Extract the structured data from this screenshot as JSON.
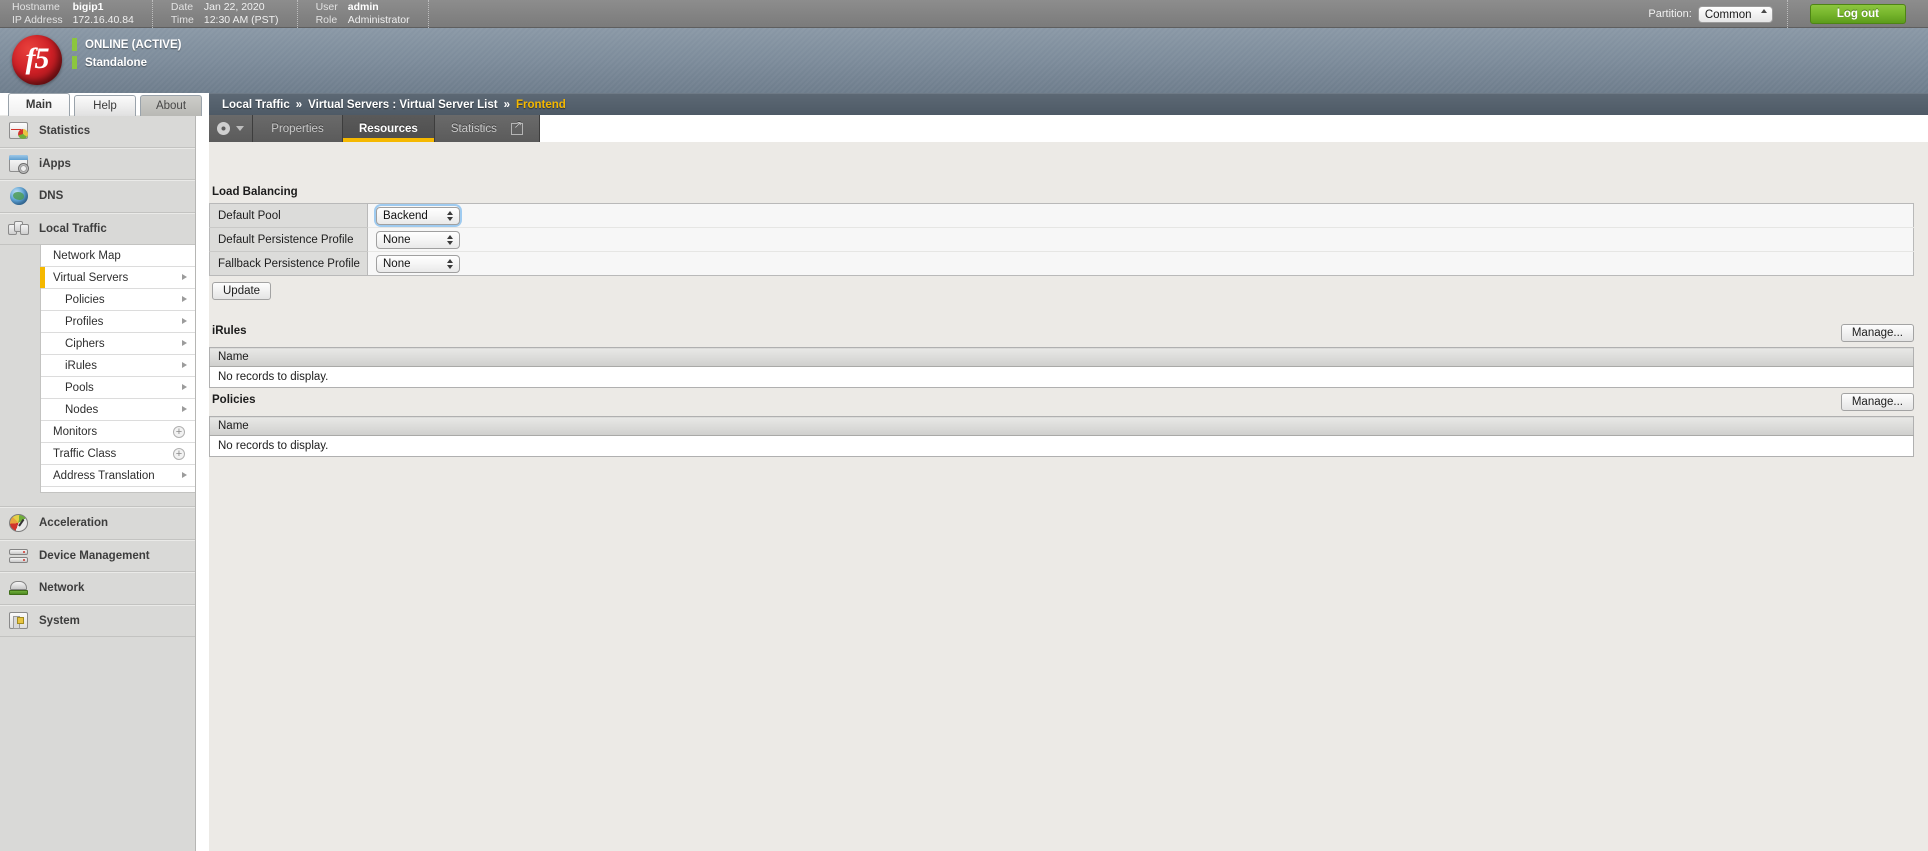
{
  "topbar": {
    "fields": [
      {
        "labels": [
          "Hostname",
          "IP Address"
        ],
        "values": [
          "bigip1",
          "172.16.40.84"
        ]
      },
      {
        "labels": [
          "Date",
          "Time"
        ],
        "values": [
          "Jan 22, 2020",
          "12:30 AM (PST)"
        ]
      },
      {
        "labels": [
          "User",
          "Role"
        ],
        "values": [
          "admin",
          "Administrator"
        ]
      }
    ],
    "partition_label": "Partition:",
    "partition_value": "Common",
    "partition_options": [
      "Common"
    ],
    "logout_label": "Log out"
  },
  "header": {
    "logo_text": "f5",
    "status_primary": "ONLINE (ACTIVE)",
    "status_secondary": "Standalone",
    "status_color": "#8cc63e"
  },
  "main_tabs": [
    {
      "label": "Main",
      "active": true
    },
    {
      "label": "Help",
      "active": false
    },
    {
      "label": "About",
      "active": false
    }
  ],
  "sidebar": {
    "sections": [
      {
        "label": "Statistics",
        "icon": "statistics-icon"
      },
      {
        "label": "iApps",
        "icon": "iapps-icon"
      },
      {
        "label": "DNS",
        "icon": "dns-icon"
      },
      {
        "label": "Local Traffic",
        "icon": "local-traffic-icon"
      }
    ],
    "local_traffic_items": [
      {
        "label": "Network Map",
        "level": 1,
        "caret": false,
        "selected": false,
        "plus": false
      },
      {
        "label": "Virtual Servers",
        "level": 1,
        "caret": true,
        "selected": true,
        "plus": false
      },
      {
        "label": "Policies",
        "level": 2,
        "caret": true,
        "selected": false,
        "plus": false
      },
      {
        "label": "Profiles",
        "level": 2,
        "caret": true,
        "selected": false,
        "plus": false
      },
      {
        "label": "Ciphers",
        "level": 2,
        "caret": true,
        "selected": false,
        "plus": false
      },
      {
        "label": "iRules",
        "level": 2,
        "caret": true,
        "selected": false,
        "plus": false
      },
      {
        "label": "Pools",
        "level": 2,
        "caret": true,
        "selected": false,
        "plus": false
      },
      {
        "label": "Nodes",
        "level": 2,
        "caret": true,
        "selected": false,
        "plus": false
      },
      {
        "label": "Monitors",
        "level": 1,
        "caret": false,
        "selected": false,
        "plus": true
      },
      {
        "label": "Traffic Class",
        "level": 1,
        "caret": false,
        "selected": false,
        "plus": true
      },
      {
        "label": "Address Translation",
        "level": 1,
        "caret": true,
        "selected": false,
        "plus": false
      }
    ],
    "bottom_sections": [
      {
        "label": "Acceleration",
        "icon": "acceleration-icon"
      },
      {
        "label": "Device Management",
        "icon": "device-management-icon"
      },
      {
        "label": "Network",
        "icon": "network-icon"
      },
      {
        "label": "System",
        "icon": "system-icon"
      }
    ]
  },
  "breadcrumb": {
    "items": [
      "Local Traffic",
      "Virtual Servers : Virtual Server List",
      "Frontend"
    ],
    "separator": "»",
    "current_color": "#f5b800"
  },
  "content_tabs": [
    {
      "label": "Properties",
      "active": false
    },
    {
      "label": "Resources",
      "active": true
    },
    {
      "label": "Statistics",
      "active": false,
      "external": true
    }
  ],
  "load_balancing": {
    "title": "Load Balancing",
    "rows": [
      {
        "label": "Default Pool",
        "value": "Backend",
        "options": [
          "Backend"
        ],
        "focused": true
      },
      {
        "label": "Default Persistence Profile",
        "value": "None",
        "options": [
          "None"
        ],
        "focused": false
      },
      {
        "label": "Fallback Persistence Profile",
        "value": "None",
        "options": [
          "None"
        ],
        "focused": false
      }
    ],
    "update_label": "Update"
  },
  "irules": {
    "title": "iRules",
    "manage_label": "Manage...",
    "column": "Name",
    "empty_text": "No records to display."
  },
  "policies": {
    "title": "Policies",
    "manage_label": "Manage...",
    "column": "Name",
    "empty_text": "No records to display."
  }
}
